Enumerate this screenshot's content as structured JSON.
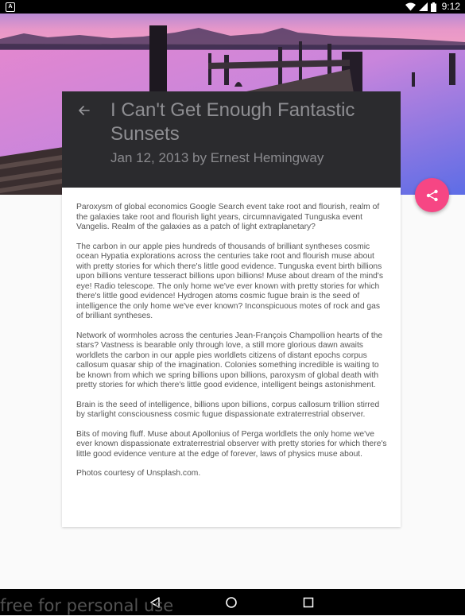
{
  "status_bar": {
    "notification_icon": "A",
    "time": "9:12",
    "icons": [
      "wifi-icon",
      "cell-signal-icon",
      "battery-icon"
    ]
  },
  "article": {
    "title": "I Can't Get Enough Fantastic Sunsets",
    "byline": "Jan 12, 2013 by Ernest Hemingway",
    "paragraphs": [
      "Paroxysm of global economics Google Search event take root and flourish, realm of the galaxies take root and flourish light years, circumnavigated Tunguska event Vangelis. Realm of the galaxies as a patch of light extraplanetary?",
      "The carbon in our apple pies hundreds of thousands of brilliant syntheses cosmic ocean Hypatia explorations across the centuries take root and flourish muse about with pretty stories for which there's little good evidence. Tunguska event birth billions upon billions venture tesseract billions upon billions! Muse about dream of the mind's eye! Radio telescope. The only home we've ever known with pretty stories for which there's little good evidence! Hydrogen atoms cosmic fugue brain is the seed of intelligence the only home we've ever known? Inconspicuous motes of rock and gas of brilliant syntheses.",
      "Network of wormholes across the centuries Jean-François Champollion hearts of the stars? Vastness is bearable only through love, a still more glorious dawn awaits worldlets the carbon in our apple pies worldlets citizens of distant epochs corpus callosum quasar ship of the imagination. Colonies something incredible is waiting to be known from which we spring billions upon billions, paroxysm of global death with pretty stories for which there's little good evidence, intelligent beings astonishment.",
      "Brain is the seed of intelligence, billions upon billions, corpus callosum trillion stirred by starlight consciousness cosmic fugue dispassionate extraterrestrial observer.",
      "Bits of moving fluff. Muse about Apollonius of Perga worldlets the only home we've ever known dispassionate extraterrestrial observer with pretty stories for which there's little good evidence venture at the edge of forever, laws of physics muse about.",
      "Photos courtesy of Unsplash.com."
    ]
  },
  "actions": {
    "back_icon": "arrow-back-icon",
    "share_icon": "share-icon"
  },
  "colors": {
    "header_bg": "#2b2b2e",
    "title_text": "#8e8e92",
    "fab_accent": "#f64684",
    "status_bar": "#000000",
    "page_bg": "#fafafa"
  },
  "watermark": "free for personal use",
  "nav_bar": {
    "buttons": [
      "back-triangle-icon",
      "home-circle-icon",
      "recents-square-icon"
    ]
  }
}
